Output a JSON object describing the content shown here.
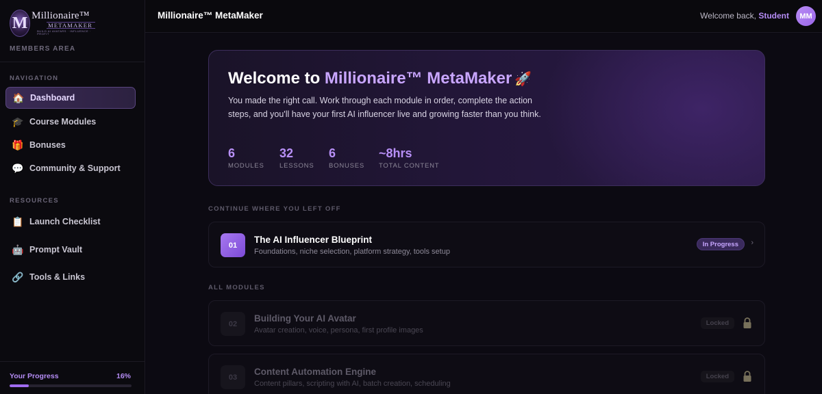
{
  "brand": {
    "logo_line1": "Millionaire™",
    "logo_line2": "METAMAKER",
    "logo_line3": "BUILD AI AVATARS · INFLUENCE · PROFIT"
  },
  "sidebar": {
    "members_area": "MEMBERS AREA",
    "navigation_label": "NAVIGATION",
    "nav_items": [
      {
        "label": "Dashboard",
        "icon": "house-icon",
        "active": true
      },
      {
        "label": "Course Modules",
        "icon": "graduation-cap-icon"
      },
      {
        "label": "Bonuses",
        "icon": "gift-icon"
      },
      {
        "label": "Community & Support",
        "icon": "speech-bubble-icon"
      }
    ],
    "resources_label": "RESOURCES",
    "resource_items": [
      {
        "label": "Launch Checklist",
        "icon": "clipboard-icon"
      },
      {
        "label": "Prompt Vault",
        "icon": "robot-icon"
      },
      {
        "label": "Tools & Links",
        "icon": "link-icon"
      }
    ],
    "progress": {
      "label": "Your Progress",
      "percent_text": "16%",
      "value": 0.16
    }
  },
  "topbar": {
    "title": "Millionaire™ MetaMaker",
    "welcome_prefix": "Welcome back,",
    "user_name": "Student",
    "avatar_initials": "MM"
  },
  "hero": {
    "title_prefix": "Welcome to ",
    "title_accent": "Millionaire™ MetaMaker",
    "description": "You made the right call. Work through each module in order, complete the action steps, and you'll have your first AI influencer live and growing faster than you think.",
    "stats": [
      {
        "value": "6",
        "label": "MODULES"
      },
      {
        "value": "32",
        "label": "LESSONS"
      },
      {
        "value": "6",
        "label": "BONUSES"
      },
      {
        "value": "~8hrs",
        "label": "TOTAL CONTENT"
      }
    ]
  },
  "continue_section": {
    "heading": "CONTINUE WHERE YOU LEFT OFF",
    "module": {
      "number": "01",
      "title": "The AI Influencer Blueprint",
      "subtitle": "Foundations, niche selection, platform strategy, tools setup",
      "status": "In Progress"
    }
  },
  "all_modules": {
    "heading": "ALL MODULES",
    "modules": [
      {
        "number": "02",
        "title": "Building Your AI Avatar",
        "subtitle": "Avatar creation, voice, persona, first profile images",
        "status": "Locked"
      },
      {
        "number": "03",
        "title": "Content Automation Engine",
        "subtitle": "Content pillars, scripting with AI, batch creation, scheduling",
        "status": "Locked"
      }
    ]
  },
  "colors": {
    "accent": "#b58cf5",
    "background": "#0c0a12",
    "sidebar_bg": "#0b0a0f",
    "active_nav_bg": "#3a2a55",
    "badge_in_progress_bg": "#3a2a5c"
  }
}
